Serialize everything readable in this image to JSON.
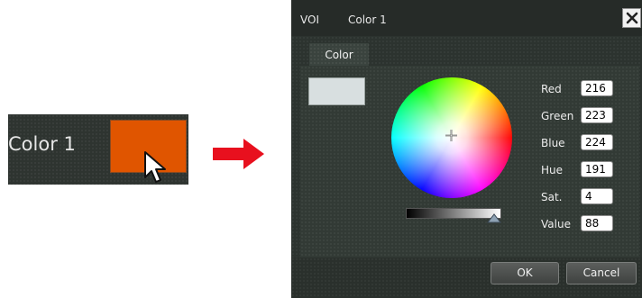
{
  "swatch": {
    "label": "Color 1",
    "color": "#e05500"
  },
  "dialog": {
    "app_label": "VOI",
    "title": "Color 1",
    "tab_label": "Color",
    "preview_color": "#d8dfe0",
    "fields": {
      "red": {
        "label": "Red",
        "value": "216"
      },
      "green": {
        "label": "Green",
        "value": "223"
      },
      "blue": {
        "label": "Blue",
        "value": "224"
      },
      "hue": {
        "label": "Hue",
        "value": "191"
      },
      "sat": {
        "label": "Sat.",
        "value": "4"
      },
      "value": {
        "label": "Value",
        "value": "88"
      }
    },
    "ok_label": "OK",
    "cancel_label": "Cancel"
  },
  "icons": {
    "pointer": "cursor-arrow-icon",
    "arrow": "right-arrow-icon",
    "close": "close-icon",
    "crosshair": "crosshair-icon",
    "thumb": "slider-thumb-icon"
  },
  "colors": {
    "arrow": "#e8101e",
    "accent": "#e05500"
  }
}
